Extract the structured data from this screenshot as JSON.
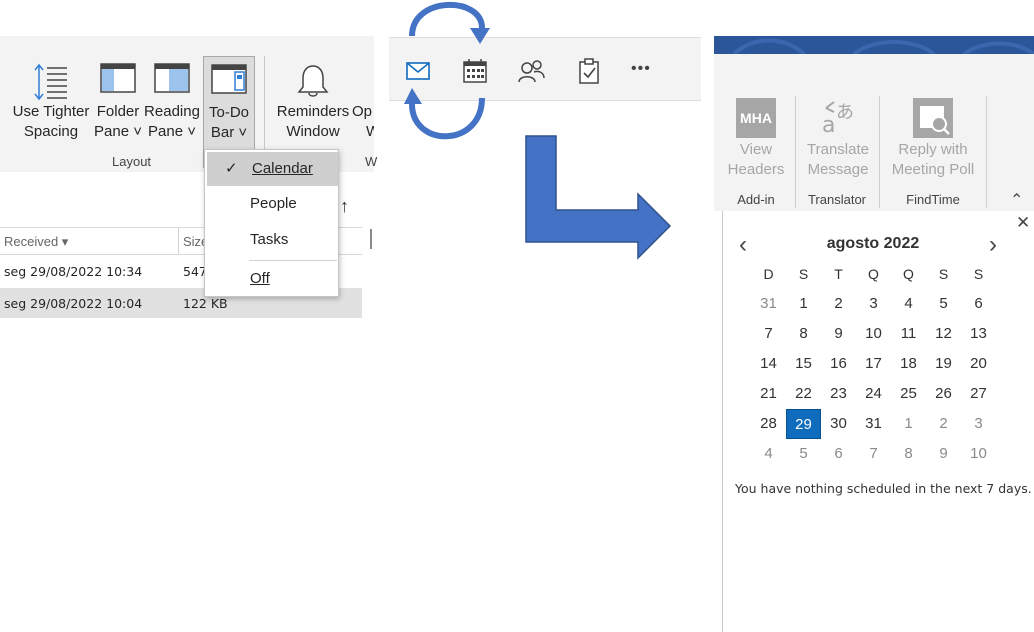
{
  "ribbon": {
    "buttons": [
      {
        "line1": "Use Tighter",
        "line2": "Spacing"
      },
      {
        "line1": "Folder",
        "line2": "Pane ˅"
      },
      {
        "line1": "Reading",
        "line2": "Pane ˅"
      },
      {
        "line1": "To-Do",
        "line2": "Bar ˅"
      },
      {
        "line1": "Reminders",
        "line2": "Window"
      },
      {
        "line1": "Op",
        "line2": "W"
      }
    ],
    "group_label": "Layout",
    "group_label_cut": "W"
  },
  "todo_menu": {
    "items": [
      {
        "label": "Calendar",
        "checked": true
      },
      {
        "label": "People",
        "checked": false
      },
      {
        "label": "Tasks",
        "checked": false
      },
      {
        "label": "Off",
        "checked": false
      }
    ],
    "check_glyph": "✓"
  },
  "mail_list": {
    "sort_arrow": "↑",
    "columns": [
      "Received ▾",
      "Size"
    ],
    "rows": [
      {
        "received": "seg 29/08/2022 10:34",
        "size": "547"
      },
      {
        "received": "seg 29/08/2022 10:04",
        "size": "122 KB"
      }
    ]
  },
  "nav_bar": {
    "icons": [
      "mail-icon",
      "calendar-icon",
      "people-icon",
      "tasks-icon",
      "more-icon"
    ],
    "more_glyph": "•••"
  },
  "right_ribbon": {
    "buttons": [
      {
        "icon_text": "MHA",
        "line1": "View",
        "line2": "Headers"
      },
      {
        "icon_text": "",
        "line1": "Translate",
        "line2": "Message"
      },
      {
        "icon_text": "",
        "line1": "Reply with",
        "line2": "Meeting Poll"
      }
    ],
    "groups": [
      "Add-in",
      "Translator",
      "FindTime"
    ],
    "collapse_glyph": "⌃"
  },
  "calendar": {
    "close_glyph": "✕",
    "prev_glyph": "‹",
    "next_glyph": "›",
    "month_title": "agosto 2022",
    "weekdays": [
      "D",
      "S",
      "T",
      "Q",
      "Q",
      "S",
      "S"
    ],
    "weeks": [
      [
        "31",
        "1",
        "2",
        "3",
        "4",
        "5",
        "6"
      ],
      [
        "7",
        "8",
        "9",
        "10",
        "11",
        "12",
        "13"
      ],
      [
        "14",
        "15",
        "16",
        "17",
        "18",
        "19",
        "20"
      ],
      [
        "21",
        "22",
        "23",
        "24",
        "25",
        "26",
        "27"
      ],
      [
        "28",
        "29",
        "30",
        "31",
        "1",
        "2",
        "3"
      ],
      [
        "4",
        "5",
        "6",
        "7",
        "8",
        "9",
        "10"
      ]
    ],
    "muted": [
      [
        0,
        0
      ],
      [
        4,
        4
      ],
      [
        4,
        5
      ],
      [
        4,
        6
      ],
      [
        5,
        0
      ],
      [
        5,
        1
      ],
      [
        5,
        2
      ],
      [
        5,
        3
      ],
      [
        5,
        4
      ],
      [
        5,
        5
      ],
      [
        5,
        6
      ]
    ],
    "today": [
      4,
      1
    ],
    "empty_message": "You have nothing scheduled in the next 7 days."
  },
  "colors": {
    "accent": "#0f6cbd",
    "arrow_blue": "#4472c4",
    "ribbon_bg": "#f3f3f3"
  }
}
